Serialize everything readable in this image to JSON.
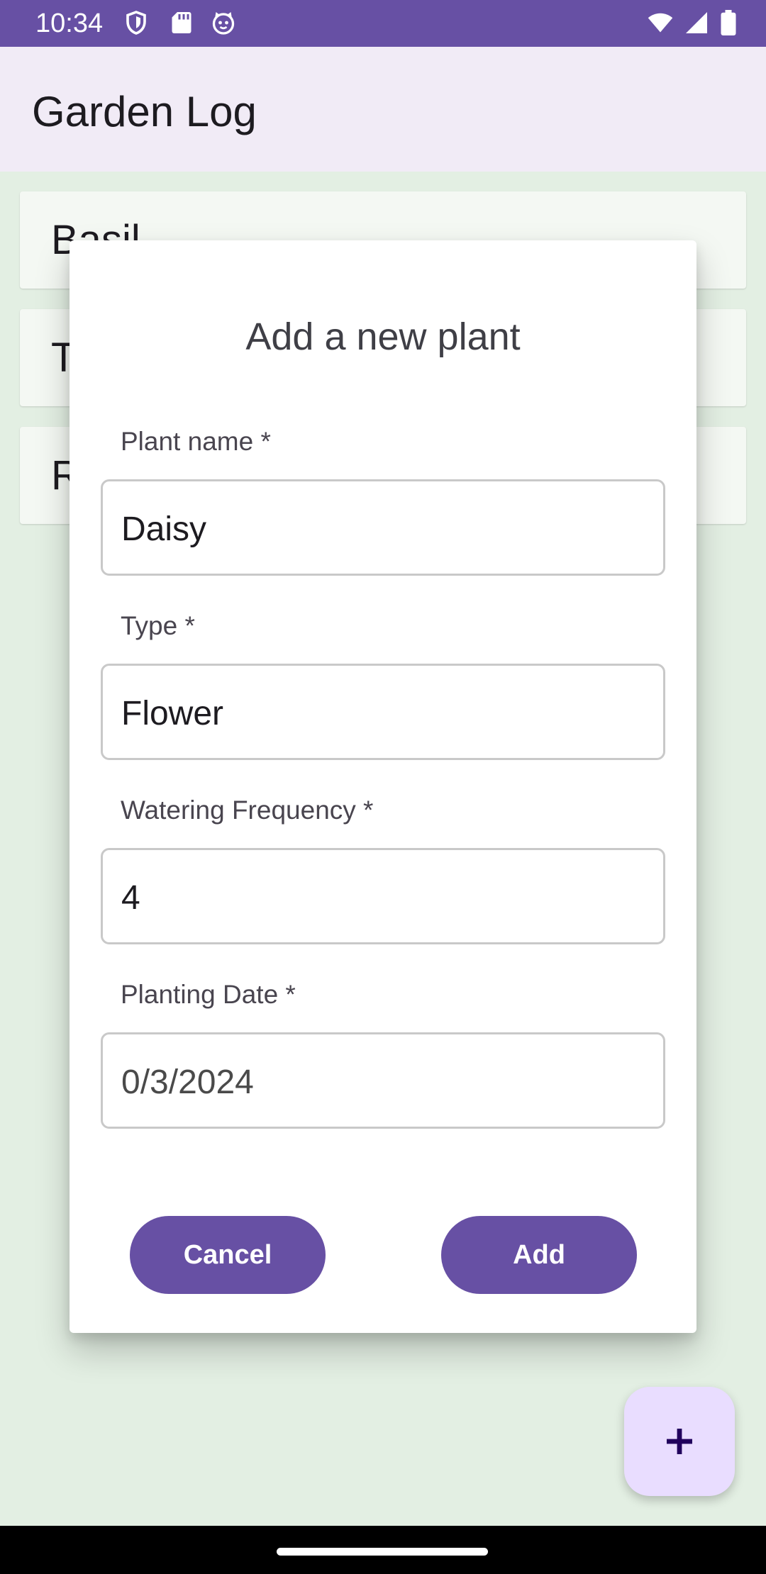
{
  "status_bar": {
    "time": "10:34",
    "icons": [
      "shield-icon",
      "sd-card-icon",
      "cat-face-icon",
      "wifi-icon",
      "cellular-signal-icon",
      "battery-icon"
    ]
  },
  "app_bar": {
    "title": "Garden Log"
  },
  "plant_list": {
    "items": [
      {
        "label": "Basil"
      },
      {
        "label": "T"
      },
      {
        "label": "R"
      }
    ]
  },
  "dialog": {
    "title": "Add a new plant",
    "fields": [
      {
        "label": "Plant name *",
        "value": "Daisy"
      },
      {
        "label": "Type *",
        "value": "Flower"
      },
      {
        "label": "Watering Frequency *",
        "value": "4"
      },
      {
        "label": "Planting Date *",
        "value": "0/3/2024"
      }
    ],
    "cancel_label": "Cancel",
    "add_label": "Add"
  },
  "fab": {
    "icon": "plus-icon"
  },
  "colors": {
    "primary": "#6750a4",
    "app_bar_bg": "#f1ebf6",
    "content_bg": "#e3efe3",
    "fab_bg": "#e9ddff"
  }
}
